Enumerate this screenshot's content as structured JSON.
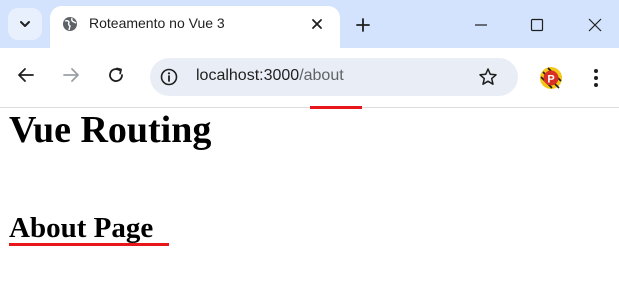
{
  "browser": {
    "tab": {
      "title": "Roteamento no Vue 3",
      "favicon": "globe-icon"
    },
    "address_bar": {
      "host": "localhost:3000",
      "path": "/about"
    },
    "accent_colors": {
      "tabstrip": "#d3e3fd",
      "omnibox": "#e9eef6",
      "annotation_underline": "#e8151b"
    }
  },
  "page": {
    "heading": "Vue Routing",
    "subheading": "About Page"
  }
}
